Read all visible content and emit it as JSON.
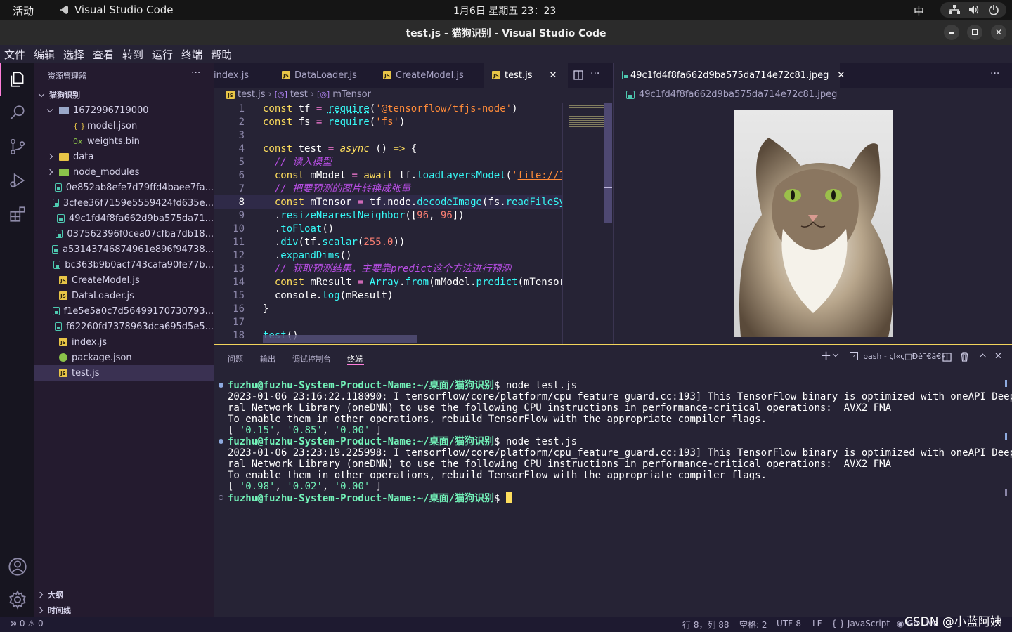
{
  "topbar": {
    "activities": "活动",
    "app_name": "Visual Studio Code",
    "datetime": "1月6日 星期五 23：23",
    "ime": "中"
  },
  "window": {
    "title": "test.js - 猫狗识别 - Visual Studio Code"
  },
  "menu": [
    "文件",
    "编辑",
    "选择",
    "查看",
    "转到",
    "运行",
    "终端",
    "帮助"
  ],
  "sidebar": {
    "header": "资源管理器",
    "more": "···",
    "root": "猫狗识别",
    "items": [
      {
        "label": "1672996719000",
        "kind": "folder-open",
        "level": 1
      },
      {
        "label": "model.json",
        "kind": "json",
        "icon": "{ }",
        "level": 2
      },
      {
        "label": "weights.bin",
        "kind": "bin",
        "icon": "0x",
        "level": 2
      },
      {
        "label": "data",
        "kind": "folder",
        "level": 1
      },
      {
        "label": "node_modules",
        "kind": "folder-green",
        "level": 1
      },
      {
        "label": "0e852ab8efe7d79ffd4baee7fa...",
        "kind": "image",
        "level": 1
      },
      {
        "label": "3cfee36f7159e5559424fd635e...",
        "kind": "image",
        "level": 1
      },
      {
        "label": "49c1fd4f8fa662d9ba575da71...",
        "kind": "image",
        "level": 1
      },
      {
        "label": "037562396f0cea07cfba7db18...",
        "kind": "image",
        "level": 1
      },
      {
        "label": "a53143746874961e896f94738...",
        "kind": "image",
        "level": 1
      },
      {
        "label": "bc363b9b0acf743cafa90fe77b...",
        "kind": "image",
        "level": 1
      },
      {
        "label": "CreateModel.js",
        "kind": "js",
        "level": 1
      },
      {
        "label": "DataLoader.js",
        "kind": "js",
        "level": 1
      },
      {
        "label": "f1e5e5a0c7d56499170730793...",
        "kind": "image",
        "level": 1
      },
      {
        "label": "f62260fd7378963dca695d5e5...",
        "kind": "image",
        "level": 1
      },
      {
        "label": "index.js",
        "kind": "js",
        "level": 1
      },
      {
        "label": "package.json",
        "kind": "pkg",
        "level": 1
      },
      {
        "label": "test.js",
        "kind": "js",
        "level": 1,
        "selected": true
      }
    ],
    "outline": "大纲",
    "timeline": "时间线"
  },
  "editor": {
    "tabs": [
      {
        "label": "index.js"
      },
      {
        "label": "DataLoader.js"
      },
      {
        "label": "CreateModel.js"
      },
      {
        "label": "test.js",
        "active": true
      }
    ],
    "close": "✕",
    "more": "···",
    "breadcrumb": [
      "test.js",
      "test",
      "mTensor"
    ],
    "line_numbers": [
      "1",
      "2",
      "3",
      "4",
      "5",
      "6",
      "7",
      "8",
      "9",
      "10",
      "11",
      "12",
      "13",
      "14",
      "15",
      "16",
      "17",
      "18"
    ]
  },
  "preview": {
    "tab": "49c1fd4f8fa662d9ba575da714e72c81.jpeg",
    "breadcrumb": "49c1fd4f8fa662d9ba575da714e72c81.jpeg",
    "close": "✕",
    "more": "···"
  },
  "panel": {
    "tabs": [
      "问题",
      "输出",
      "调试控制台",
      "终端"
    ],
    "active_tab": "终端",
    "shell": "bash - çl«ç□Ðè¯€ã€«",
    "plus": "+",
    "terminal": {
      "prompt": "fuzhu@fuzhu-System-Product-Name:~/桌面/猫狗识别",
      "cmd1": "$ node test.js",
      "log1a": "2023-01-06 23:16:22.118090: I tensorflow/core/platform/cpu_feature_guard.cc:193] This TensorFlow binary is optimized with oneAPI Deep Neu",
      "log1b": "ral Network Library (oneDNN) to use the following CPU instructions in performance-critical operations:  AVX2 FMA",
      "log1c": "To enable them in other operations, rebuild TensorFlow with the appropriate compiler flags.",
      "result1": [
        "'0.15'",
        "'0.85'",
        "'0.00'"
      ],
      "cmd2": "$ node test.js",
      "log2a": "2023-01-06 23:23:19.225998: I tensorflow/core/platform/cpu_feature_guard.cc:193] This TensorFlow binary is optimized with oneAPI Deep Neu",
      "log2b": "ral Network Library (oneDNN) to use the following CPU instructions in performance-critical operations:  AVX2 FMA",
      "log2c": "To enable them in other operations, rebuild TensorFlow with the appropriate compiler flags.",
      "result2": [
        "'0.98'",
        "'0.02'",
        "'0.00'"
      ],
      "cmd3": "$ "
    }
  },
  "status": {
    "errors": "0",
    "warnings": "0",
    "position": "行 8，列 88",
    "spaces": "空格: 2",
    "encoding": "UTF-8",
    "eol": "LF",
    "language": "{ } JavaScript",
    "golive": "Go Live",
    "watermark": "CSDN @小蓝阿姨"
  }
}
